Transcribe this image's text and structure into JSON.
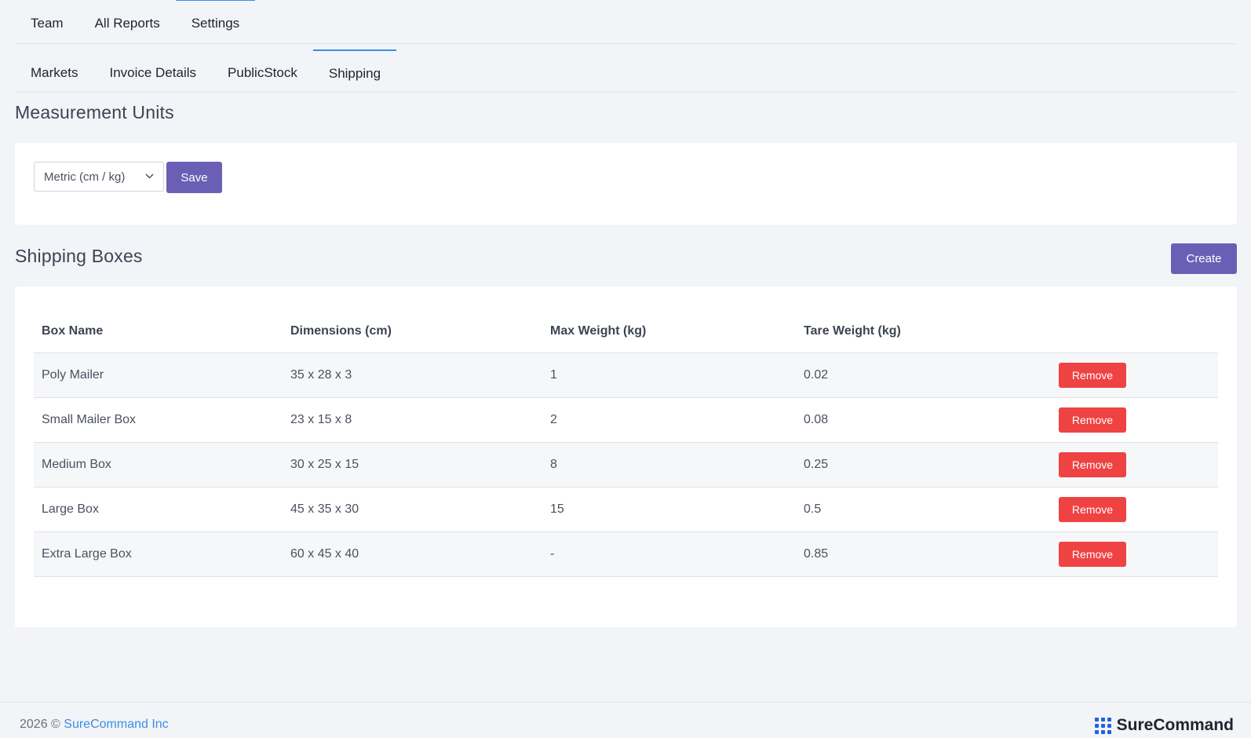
{
  "top_tabs": [
    {
      "label": "Team"
    },
    {
      "label": "All Reports"
    },
    {
      "label": "Settings"
    }
  ],
  "sub_tabs": [
    {
      "label": "Markets"
    },
    {
      "label": "Invoice Details"
    },
    {
      "label": "PublicStock"
    },
    {
      "label": "Shipping"
    }
  ],
  "measurement": {
    "title": "Measurement Units",
    "selected_unit": "Metric (cm / kg)",
    "save_label": "Save"
  },
  "shipping_boxes": {
    "title": "Shipping Boxes",
    "create_label": "Create",
    "columns": [
      "Box Name",
      "Dimensions (cm)",
      "Max Weight (kg)",
      "Tare Weight (kg)"
    ],
    "remove_label": "Remove",
    "rows": [
      {
        "name": "Poly Mailer",
        "dimensions": "35 x 28 x 3",
        "max_weight": "1",
        "tare_weight": "0.02"
      },
      {
        "name": "Small Mailer Box",
        "dimensions": "23 x 15 x 8",
        "max_weight": "2",
        "tare_weight": "0.08"
      },
      {
        "name": "Medium Box",
        "dimensions": "30 x 25 x 15",
        "max_weight": "8",
        "tare_weight": "0.25"
      },
      {
        "name": "Large Box",
        "dimensions": "45 x 35 x 30",
        "max_weight": "15",
        "tare_weight": "0.5"
      },
      {
        "name": "Extra Large Box",
        "dimensions": "60 x 45 x 40",
        "max_weight": "-",
        "tare_weight": "0.85"
      }
    ]
  },
  "footer": {
    "year": "2026 ©",
    "company_link": "SureCommand Inc",
    "brand": "SureCommand"
  },
  "colors": {
    "accent": "#3a8ee6",
    "primary_button": "#6b5fb5",
    "danger_button": "#ef4343",
    "brand_icon": "#1e63e0"
  }
}
